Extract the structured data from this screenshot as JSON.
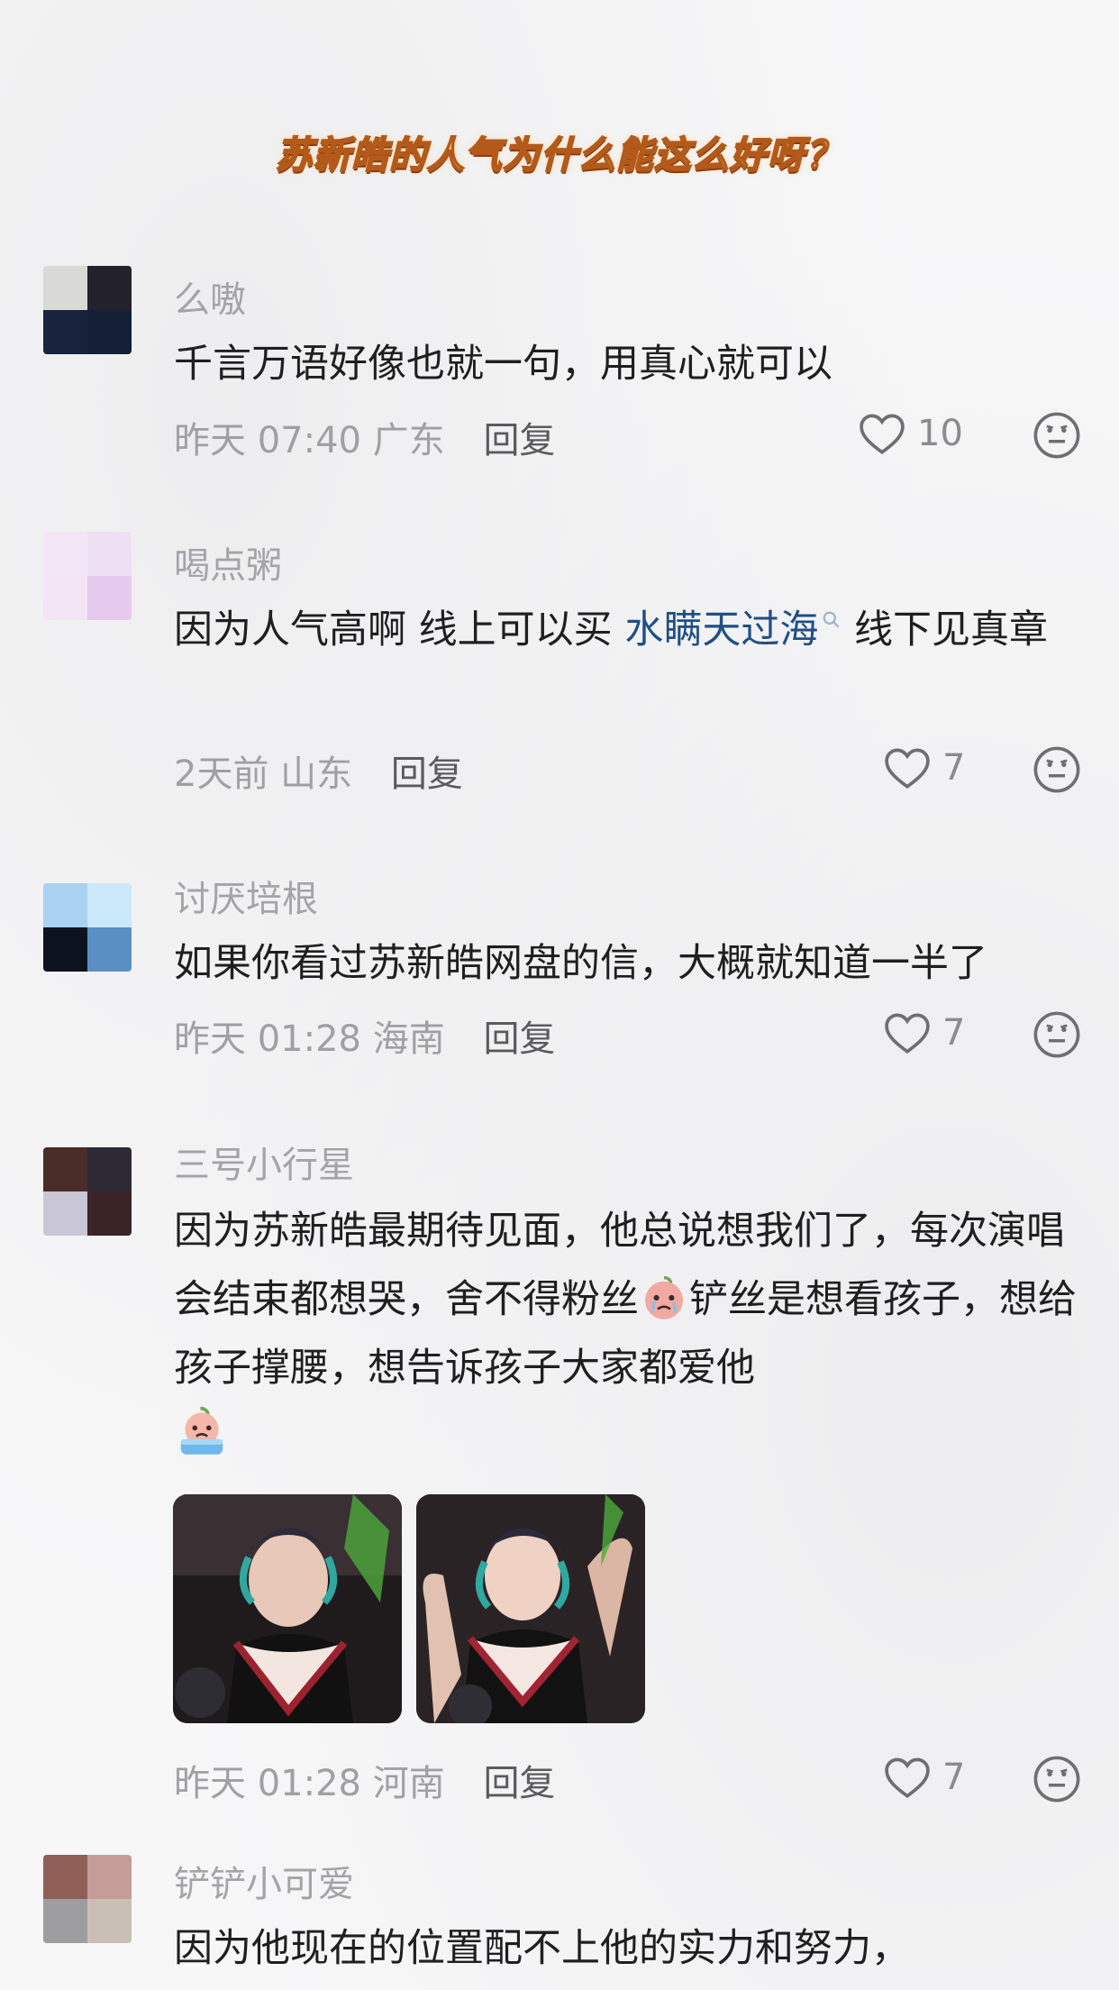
{
  "post": {
    "title": "苏新皓的人气为什么能这么好呀？"
  },
  "comments": [
    {
      "username": "么嗷",
      "text": "千言万语好像也就一句，用真心就可以",
      "time": "昨天 07:40",
      "location": "广东",
      "reply_label": "回复",
      "likes": "10"
    },
    {
      "username": "喝点粥",
      "text_before": "因为人气高啊 线上可以买 ",
      "search_link": "水瞒天过海",
      "text_after": " 线下见真章",
      "time": "2天前",
      "location": "山东",
      "reply_label": "回复",
      "likes": "7"
    },
    {
      "username": "讨厌培根",
      "text": "如果你看过苏新皓网盘的信，大概就知道一半了",
      "time": "昨天 01:28",
      "location": "海南",
      "reply_label": "回复",
      "likes": "7"
    },
    {
      "username": "三号小行星",
      "text_part1": "因为苏新皓最期待见面，他总说想我们了，每次演唱会结束都想哭，舍不得粉丝",
      "text_part2": "铲丝是想看孩子，想给孩子撑腰，想告诉孩子大家都爱他",
      "time": "昨天 01:28",
      "location": "河南",
      "reply_label": "回复",
      "likes": "7"
    },
    {
      "username": "铲铲小可爱",
      "text": "因为他现在的位置配不上他的实力和努力，"
    }
  ],
  "icons": {
    "like": "heart-outline-icon",
    "emoji": "neutral-face-icon",
    "search": "search-mini-icon"
  },
  "colors": {
    "link": "#1f4f86",
    "title_fill": "#f6c47a",
    "title_stroke": "#b35a1a"
  }
}
